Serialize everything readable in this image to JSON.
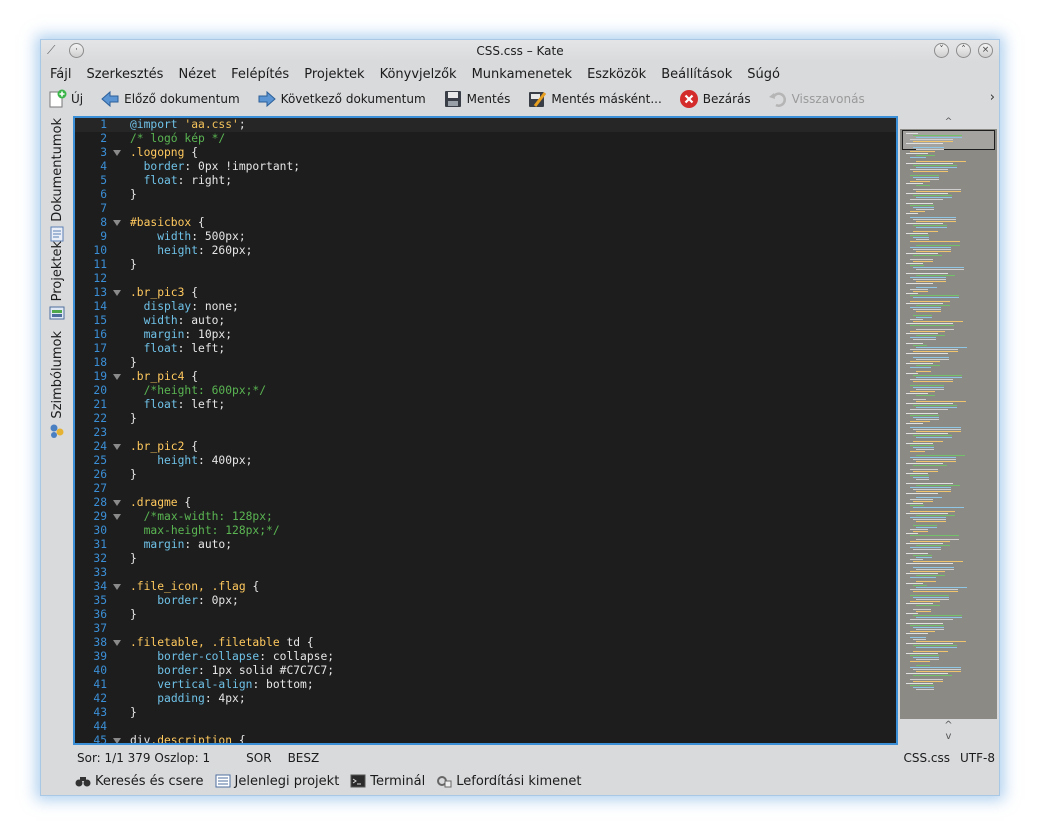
{
  "window": {
    "title": "CSS.css – Kate"
  },
  "menu": [
    "Fájl",
    "Szerkesztés",
    "Nézet",
    "Felépítés",
    "Projektek",
    "Könyvjelzők",
    "Munkamenetek",
    "Eszközök",
    "Beállítások",
    "Súgó"
  ],
  "toolbar": {
    "new": "Új",
    "prev_doc": "Előző dokumentum",
    "next_doc": "Következő dokumentum",
    "save": "Mentés",
    "save_as": "Mentés másként...",
    "close": "Bezárás",
    "undo": "Visszavonás",
    "more": "›"
  },
  "side_tabs": {
    "documents": "Dokumentumok",
    "projects": "Projektek",
    "symbols": "Szimbólumok"
  },
  "code": [
    {
      "n": "1",
      "fold": false,
      "segs": [
        [
          "at",
          "@import "
        ],
        [
          "str",
          "'aa.css'"
        ],
        [
          "txt",
          ";"
        ]
      ]
    },
    {
      "n": "2",
      "fold": false,
      "segs": [
        [
          "com",
          "/* logó kép */"
        ]
      ]
    },
    {
      "n": "3",
      "fold": true,
      "segs": [
        [
          "sel",
          ".logopng "
        ],
        [
          "txt",
          "{"
        ]
      ]
    },
    {
      "n": "4",
      "fold": false,
      "segs": [
        [
          "txt",
          "  "
        ],
        [
          "prop",
          "border"
        ],
        [
          "txt",
          ": 0px !important;"
        ]
      ]
    },
    {
      "n": "5",
      "fold": false,
      "segs": [
        [
          "txt",
          "  "
        ],
        [
          "prop",
          "float"
        ],
        [
          "txt",
          ": right;"
        ]
      ]
    },
    {
      "n": "6",
      "fold": false,
      "segs": [
        [
          "txt",
          "}"
        ]
      ]
    },
    {
      "n": "7",
      "fold": false,
      "segs": []
    },
    {
      "n": "8",
      "fold": true,
      "segs": [
        [
          "sel",
          "#basicbox "
        ],
        [
          "txt",
          "{"
        ]
      ]
    },
    {
      "n": "9",
      "fold": false,
      "segs": [
        [
          "txt",
          "    "
        ],
        [
          "prop",
          "width"
        ],
        [
          "txt",
          ": 500px;"
        ]
      ]
    },
    {
      "n": "10",
      "fold": false,
      "segs": [
        [
          "txt",
          "    "
        ],
        [
          "prop",
          "height"
        ],
        [
          "txt",
          ": 260px;"
        ]
      ]
    },
    {
      "n": "11",
      "fold": false,
      "segs": [
        [
          "txt",
          "}"
        ]
      ]
    },
    {
      "n": "12",
      "fold": false,
      "segs": []
    },
    {
      "n": "13",
      "fold": true,
      "segs": [
        [
          "sel",
          ".br_pic3 "
        ],
        [
          "txt",
          "{"
        ]
      ]
    },
    {
      "n": "14",
      "fold": false,
      "segs": [
        [
          "txt",
          "  "
        ],
        [
          "prop",
          "display"
        ],
        [
          "txt",
          ": none;"
        ]
      ]
    },
    {
      "n": "15",
      "fold": false,
      "segs": [
        [
          "txt",
          "  "
        ],
        [
          "prop",
          "width"
        ],
        [
          "txt",
          ": auto;"
        ]
      ]
    },
    {
      "n": "16",
      "fold": false,
      "segs": [
        [
          "txt",
          "  "
        ],
        [
          "prop",
          "margin"
        ],
        [
          "txt",
          ": 10px;"
        ]
      ]
    },
    {
      "n": "17",
      "fold": false,
      "segs": [
        [
          "txt",
          "  "
        ],
        [
          "prop",
          "float"
        ],
        [
          "txt",
          ": left;"
        ]
      ]
    },
    {
      "n": "18",
      "fold": false,
      "segs": [
        [
          "txt",
          "}"
        ]
      ]
    },
    {
      "n": "19",
      "fold": true,
      "segs": [
        [
          "sel",
          ".br_pic4 "
        ],
        [
          "txt",
          "{"
        ]
      ]
    },
    {
      "n": "20",
      "fold": false,
      "segs": [
        [
          "txt",
          "  "
        ],
        [
          "com",
          "/*height: 600px;*/"
        ]
      ]
    },
    {
      "n": "21",
      "fold": false,
      "segs": [
        [
          "txt",
          "  "
        ],
        [
          "prop",
          "float"
        ],
        [
          "txt",
          ": left;"
        ]
      ]
    },
    {
      "n": "22",
      "fold": false,
      "segs": [
        [
          "txt",
          "}"
        ]
      ]
    },
    {
      "n": "23",
      "fold": false,
      "segs": []
    },
    {
      "n": "24",
      "fold": true,
      "segs": [
        [
          "sel",
          ".br_pic2 "
        ],
        [
          "txt",
          "{"
        ]
      ]
    },
    {
      "n": "25",
      "fold": false,
      "segs": [
        [
          "txt",
          "    "
        ],
        [
          "prop",
          "height"
        ],
        [
          "txt",
          ": 400px;"
        ]
      ]
    },
    {
      "n": "26",
      "fold": false,
      "segs": [
        [
          "txt",
          "}"
        ]
      ]
    },
    {
      "n": "27",
      "fold": false,
      "segs": []
    },
    {
      "n": "28",
      "fold": true,
      "segs": [
        [
          "sel",
          ".dragme "
        ],
        [
          "txt",
          "{"
        ]
      ]
    },
    {
      "n": "29",
      "fold": true,
      "segs": [
        [
          "txt",
          "  "
        ],
        [
          "com",
          "/*max-width: 128px;"
        ]
      ]
    },
    {
      "n": "30",
      "fold": false,
      "segs": [
        [
          "txt",
          "  "
        ],
        [
          "com",
          "max-height: 128px;*/"
        ]
      ]
    },
    {
      "n": "31",
      "fold": false,
      "segs": [
        [
          "txt",
          "  "
        ],
        [
          "prop",
          "margin"
        ],
        [
          "txt",
          ": auto;"
        ]
      ]
    },
    {
      "n": "32",
      "fold": false,
      "segs": [
        [
          "txt",
          "}"
        ]
      ]
    },
    {
      "n": "33",
      "fold": false,
      "segs": []
    },
    {
      "n": "34",
      "fold": true,
      "segs": [
        [
          "sel",
          ".file_icon, .flag "
        ],
        [
          "txt",
          "{"
        ]
      ]
    },
    {
      "n": "35",
      "fold": false,
      "segs": [
        [
          "txt",
          "    "
        ],
        [
          "prop",
          "border"
        ],
        [
          "txt",
          ": 0px;"
        ]
      ]
    },
    {
      "n": "36",
      "fold": false,
      "segs": [
        [
          "txt",
          "}"
        ]
      ]
    },
    {
      "n": "37",
      "fold": false,
      "segs": []
    },
    {
      "n": "38",
      "fold": true,
      "segs": [
        [
          "sel",
          ".filetable, .filetable "
        ],
        [
          "txt",
          "td {"
        ]
      ]
    },
    {
      "n": "39",
      "fold": false,
      "segs": [
        [
          "txt",
          "    "
        ],
        [
          "prop",
          "border-collapse"
        ],
        [
          "txt",
          ": collapse;"
        ]
      ]
    },
    {
      "n": "40",
      "fold": false,
      "segs": [
        [
          "txt",
          "    "
        ],
        [
          "prop",
          "border"
        ],
        [
          "txt",
          ": 1px solid #C7C7C7;"
        ]
      ]
    },
    {
      "n": "41",
      "fold": false,
      "segs": [
        [
          "txt",
          "    "
        ],
        [
          "prop",
          "vertical-align"
        ],
        [
          "txt",
          ": bottom;"
        ]
      ]
    },
    {
      "n": "42",
      "fold": false,
      "segs": [
        [
          "txt",
          "    "
        ],
        [
          "prop",
          "padding"
        ],
        [
          "txt",
          ": 4px;"
        ]
      ]
    },
    {
      "n": "43",
      "fold": false,
      "segs": [
        [
          "txt",
          "}"
        ]
      ]
    },
    {
      "n": "44",
      "fold": false,
      "segs": []
    },
    {
      "n": "45",
      "fold": true,
      "segs": [
        [
          "txt",
          "div"
        ],
        [
          "sel",
          ".description "
        ],
        [
          "txt",
          "{"
        ]
      ]
    }
  ],
  "status": {
    "position": "Sor: 1/1 379 Oszlop: 1",
    "mode": "SOR",
    "insert": "BESZ",
    "filename": "CSS.css",
    "encoding": "UTF-8"
  },
  "bottom_tabs": {
    "search": "Keresés és csere",
    "project": "Jelenlegi projekt",
    "terminal": "Terminál",
    "build": "Lefordítási kimenet"
  },
  "colors": {
    "editor_bg": "#1d1d1d",
    "line_number": "#3b8fd6",
    "selector": "#ffc95e",
    "comment": "#5ab552",
    "property": "#6fc2e8",
    "focus_border": "#3b8fd6"
  }
}
